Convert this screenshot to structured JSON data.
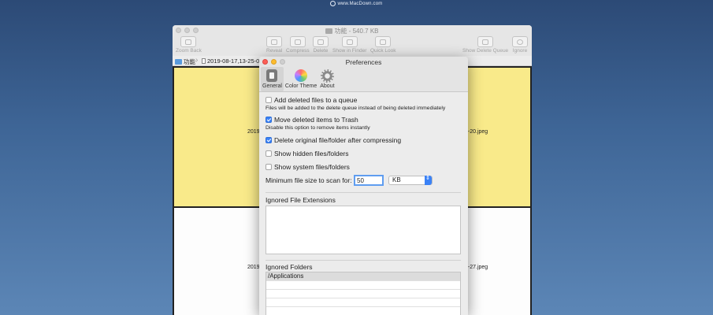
{
  "watermark": {
    "text": "www.MacDown.com"
  },
  "main_window": {
    "title": "功能 - 540.7 KB",
    "toolbar": {
      "zoom_back": "Zoom Back",
      "reveal": "Reveal",
      "compress": "Compress",
      "delete": "Delete",
      "show_in_finder": "Show in Finder",
      "quick_look": "Quick Look",
      "show_delete_queue": "Show Delete Queue",
      "ignore": "Ignore"
    },
    "path": {
      "folder": "功能",
      "file": "2019-08-17,13-25-02"
    },
    "cells": {
      "cell1_left": "2019",
      "cell1_right": "5-20.jpeg",
      "cell2_left": "2019",
      "cell2_right": "5-27.jpeg"
    }
  },
  "preferences": {
    "title": "Preferences",
    "tabs": {
      "general": "General",
      "color_theme": "Color Theme",
      "about": "About"
    },
    "options": {
      "add_deleted": "Add deleted files to a queue",
      "add_deleted_desc": "Files will be added to the delete queue instead of being deleted immediately",
      "move_trash": "Move deleted items to Trash",
      "move_trash_desc": "Disable this option to remove items instantly",
      "delete_original": "Delete original file/folder after compressing",
      "show_hidden": "Show hidden files/folders",
      "show_system": "Show system files/folders"
    },
    "min_size_label": "Minimum file size to scan for:",
    "min_size_value": "50",
    "unit": "KB",
    "ignored_ext_label": "Ignored File Extensions",
    "ignored_folders_label": "Ignored Folders",
    "ignored_folders": [
      "/Applications",
      "",
      "",
      "",
      ""
    ]
  }
}
